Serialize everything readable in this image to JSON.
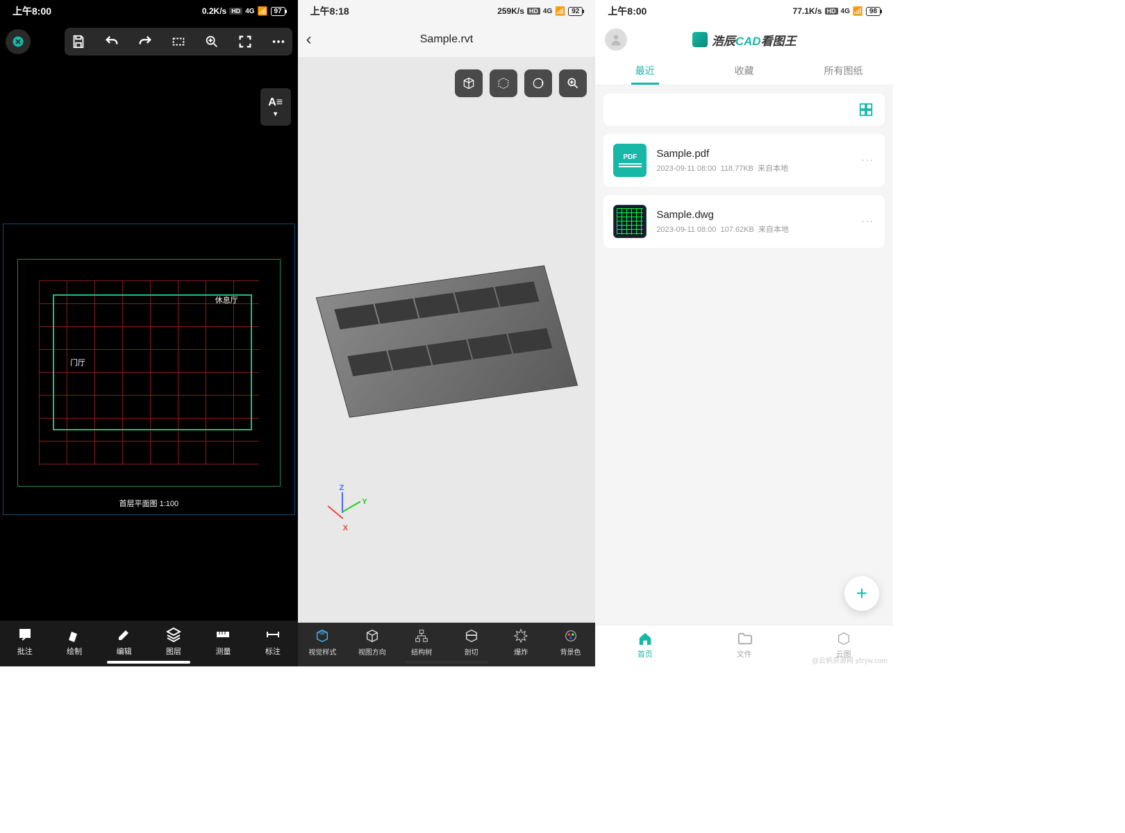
{
  "screen1": {
    "status": {
      "time": "上午8:00",
      "speed": "0.2K/s",
      "hd": "HD",
      "net": "4G",
      "battery": "97"
    },
    "text_tool": "A≡",
    "cad": {
      "title": "首层平面图  1:100",
      "room1": "休息厅",
      "room2": "门厅"
    },
    "bottom": [
      "批注",
      "绘制",
      "编辑",
      "图层",
      "测量",
      "标注"
    ]
  },
  "screen2": {
    "status": {
      "time": "上午8:18",
      "speed": "259K/s",
      "hd": "HD",
      "net": "4G",
      "battery": "92"
    },
    "title": "Sample.rvt",
    "axis": {
      "x": "X",
      "y": "Y",
      "z": "Z"
    },
    "bottom": [
      "视觉样式",
      "视图方向",
      "结构树",
      "剖切",
      "爆炸",
      "背景色"
    ]
  },
  "screen3": {
    "status": {
      "time": "上午8:00",
      "speed": "77.1K/s",
      "hd": "HD",
      "net": "4G",
      "battery": "98"
    },
    "brand": {
      "prefix": "浩辰",
      "cad": "CAD",
      "suffix": "看图王"
    },
    "tabs": [
      "最近",
      "收藏",
      "所有图纸"
    ],
    "files": [
      {
        "name": "Sample.pdf",
        "date": "2023-09-11 08:00",
        "size": "118.77KB",
        "source": "来自本地",
        "type": "PDF"
      },
      {
        "name": "Sample.dwg",
        "date": "2023-09-11 08:00",
        "size": "107.62KB",
        "source": "来自本地",
        "type": "DWG"
      }
    ],
    "bottom": [
      "首页",
      "文件",
      "云图"
    ],
    "watermark": "@云帆资源网 yfzyw.com"
  }
}
